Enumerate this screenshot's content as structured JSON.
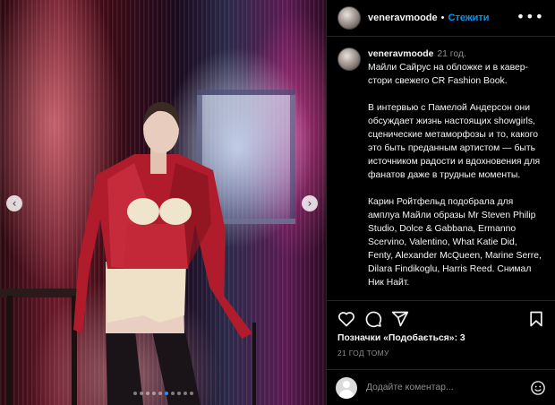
{
  "post": {
    "username": "veneravmoode",
    "separator": "•",
    "follow_label": "Стежити",
    "more_icon": "•••"
  },
  "caption": {
    "username": "veneravmoode",
    "time": "21 год.",
    "paragraphs": [
      "Майли Сайрус на обложке и в кавер-стори свежего CR Fashion Book.",
      "В интервью с Памелой Андерсон они обсуждает жизнь настоящих showgirls, сценические метаморфозы и то, какого это быть преданным артистом — быть источником радости и вдохновения для фанатов даже в трудные моменты.",
      "Карин Ройтфельд подобрала для амплуа Майли образы Mr Steven Philip Studio, Dolce & Gabbana, Ermanno Scervino, Valentino, What Katie Did, Fenty, Alexander McQueen, Marine Serre, Dilara Findikoglu, Harris Reed. Снимал Ник Найт."
    ]
  },
  "carousel": {
    "prev_icon": "‹",
    "next_icon": "›",
    "dot_count": 10,
    "active_dot": 5
  },
  "actions": {
    "icons": [
      "heart-icon",
      "comment-icon",
      "share-icon",
      "bookmark-icon"
    ]
  },
  "likes_text": "Позначки «Подобається»: 3",
  "time_ago": "21 ГОД ТОМУ",
  "comment": {
    "placeholder": "Додайте коментар..."
  },
  "colors": {
    "accent": "#0095f6",
    "background": "#000000",
    "muted": "#8e8e8e",
    "active_dot": "#1e90ff"
  }
}
